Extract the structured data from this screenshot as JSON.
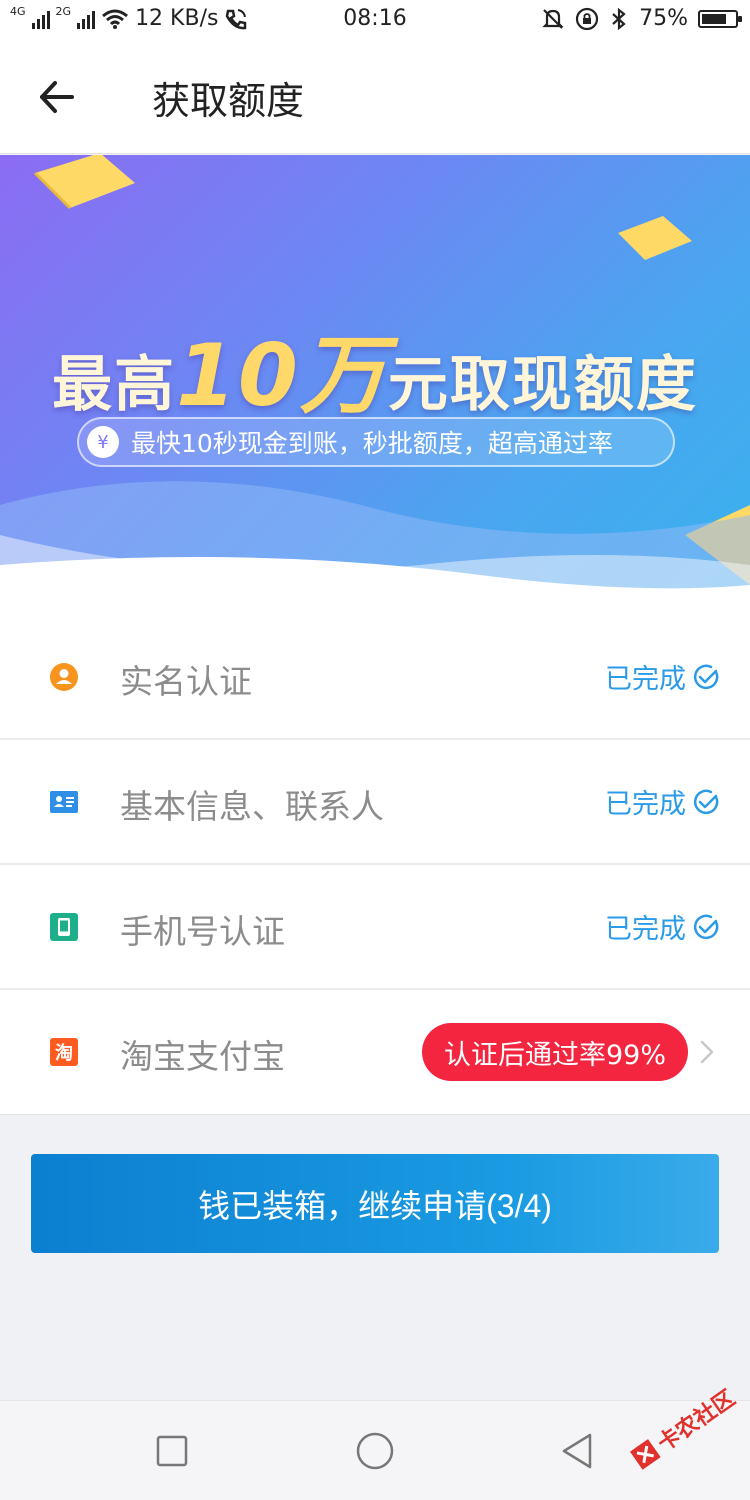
{
  "status_bar": {
    "net_left": "4G",
    "net_right": "2G",
    "speed": "12 KB/s",
    "time": "08:16",
    "battery": "75%",
    "battery_level": 0.75
  },
  "header": {
    "title": "获取额度"
  },
  "banner": {
    "title_prefix": "最高",
    "title_amount": "10万",
    "title_suffix": "元取现额度",
    "subtitle": "最快10秒现金到账，秒批额度，超高通过率",
    "yen": "¥"
  },
  "items": [
    {
      "label": "实名认证",
      "status": "已完成",
      "icon": "user-icon",
      "color": "#f7941d"
    },
    {
      "label": "基本信息、联系人",
      "status": "已完成",
      "icon": "contact-card-icon",
      "color": "#2f8fe6"
    },
    {
      "label": "手机号认证",
      "status": "已完成",
      "icon": "phone-icon",
      "color": "#1fae8a"
    },
    {
      "label": "淘宝支付宝",
      "badge": "认证后通过率99%",
      "icon": "taobao-icon",
      "color": "#ff5a1f",
      "icon_text": "淘"
    }
  ],
  "main_button": {
    "label": "钱已装箱，继续申请(3/4)"
  },
  "watermark": {
    "text": "卡农社区"
  },
  "colors": {
    "accent": "#2b9be8",
    "badge": "#f3253f",
    "button": "#1a9be2"
  }
}
